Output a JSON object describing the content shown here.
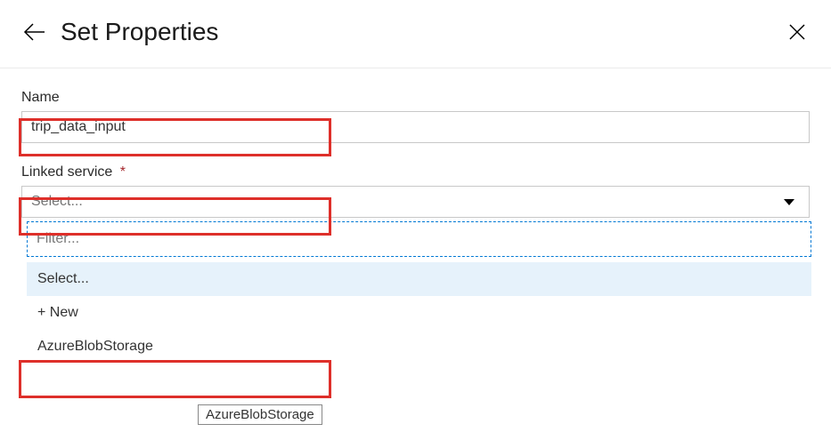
{
  "header": {
    "title": "Set Properties"
  },
  "form": {
    "name_label": "Name",
    "name_value": "trip_data_input",
    "linked_service_label": "Linked service",
    "linked_service_required": "*",
    "linked_service_placeholder": "Select...",
    "filter_placeholder": "Filter...",
    "options": [
      {
        "label": "Select..."
      },
      {
        "label": "+ New"
      },
      {
        "label": "AzureBlobStorage"
      }
    ]
  },
  "tooltip": {
    "text": "AzureBlobStorage"
  }
}
